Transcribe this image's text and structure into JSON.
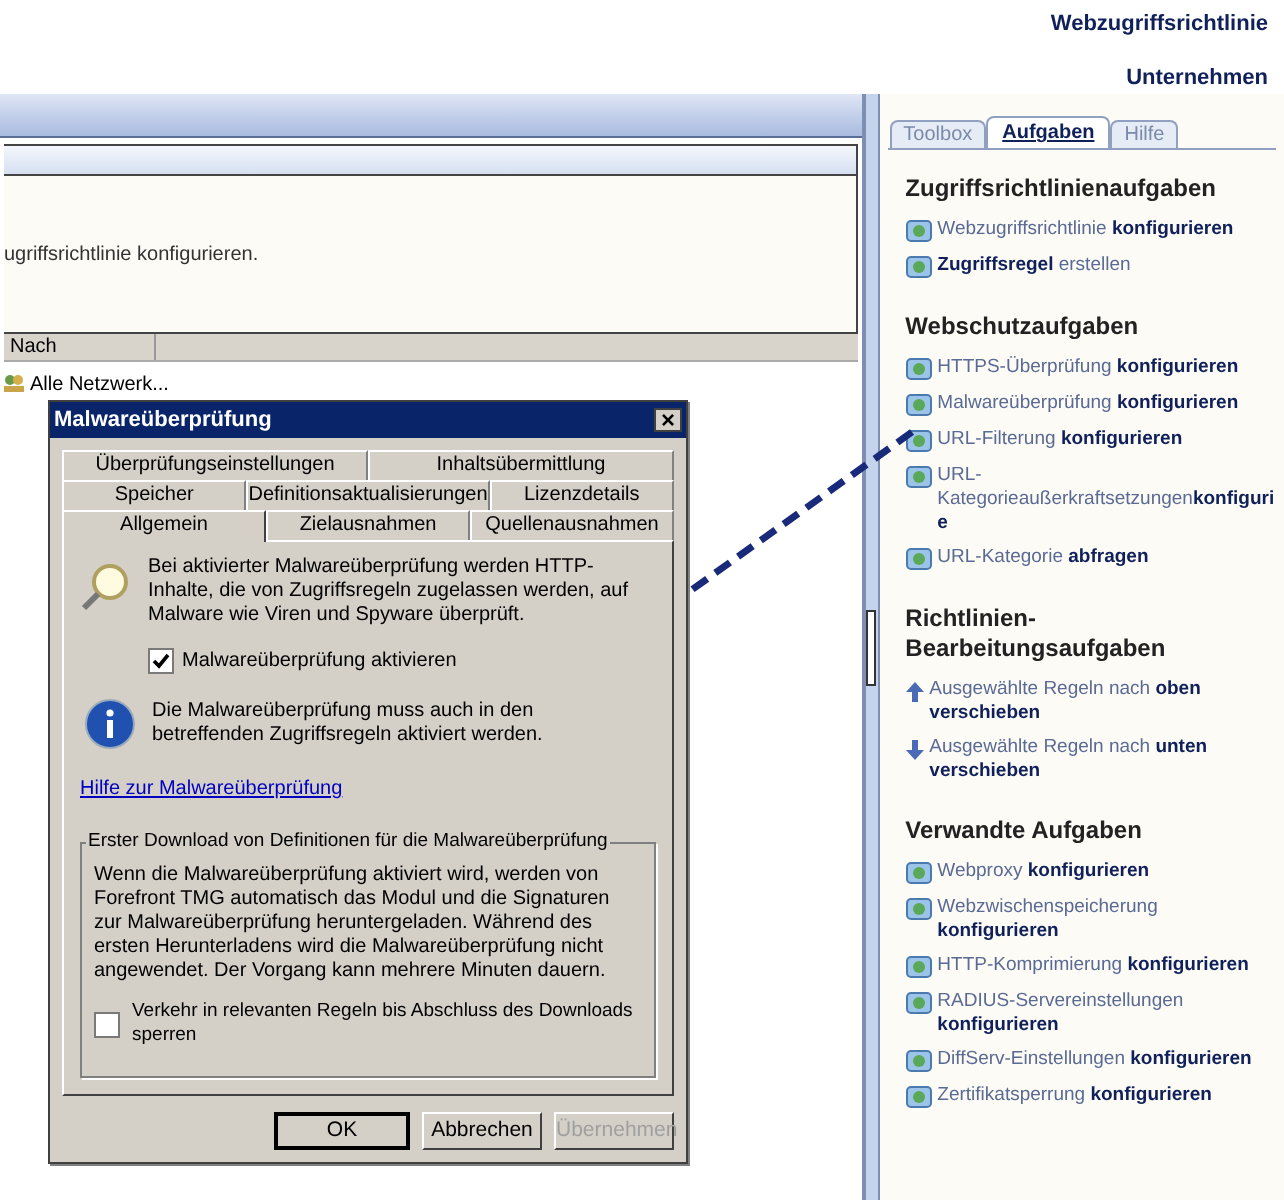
{
  "header": {
    "title": "Webzugriffsrichtlinie",
    "subtitle": "Unternehmen"
  },
  "main": {
    "description": "ugriffsrichtlinie konfigurieren.",
    "columns": [
      "Nach"
    ],
    "rows": [
      {
        "cells": [
          "Alle Netzwerk..."
        ]
      }
    ]
  },
  "dialog": {
    "title": "Malwareüberprüfung",
    "close": "×",
    "tab_rows": [
      [
        {
          "label": "Überprüfungseinstellungen",
          "selected": false
        },
        {
          "label": "Inhaltsübermittlung",
          "selected": false
        }
      ],
      [
        {
          "label": "Speicher",
          "selected": false
        },
        {
          "label": "Definitionsaktualisierungen",
          "selected": false
        },
        {
          "label": "Lizenzdetails",
          "selected": false
        }
      ],
      [
        {
          "label": "Allgemein",
          "selected": true
        },
        {
          "label": "Zielausnahmen",
          "selected": false
        },
        {
          "label": "Quellenausnahmen",
          "selected": false
        }
      ]
    ],
    "intro": "Bei aktivierter Malwareüberprüfung werden HTTP-Inhalte, die von Zugriffsregeln zugelassen werden, auf Malware wie Viren und Spyware überprüft.",
    "enable": {
      "label": "Malwareüberprüfung aktivieren",
      "checked": true
    },
    "info": "Die Malwareüberprüfung muss auch in den betreffenden Zugriffsregeln aktiviert werden.",
    "help_link": "Hilfe zur Malwareüberprüfung",
    "group": {
      "title": "Erster Download von Definitionen für die Malwareüberprüfung",
      "text": "Wenn die Malwareüberprüfung aktiviert wird, werden von Forefront TMG automatisch das Modul und die Signaturen zur Malwareüberprüfung heruntergeladen. Während des ersten Herunterladens wird die Malwareüberprüfung nicht angewendet. Der Vorgang kann mehrere Minuten dauern.",
      "checkbox": {
        "label": "Verkehr in relevanten Regeln bis Abschluss des Downloads sperren",
        "checked": false
      }
    },
    "buttons": [
      {
        "label": "OK",
        "disabled": false
      },
      {
        "label": "Abbrechen",
        "disabled": false
      },
      {
        "label": "Übernehmen",
        "disabled": true
      }
    ]
  },
  "taskpane": {
    "tabs": [
      {
        "label": "Toolbox",
        "selected": false
      },
      {
        "label": "Aufgaben",
        "selected": true
      },
      {
        "label": "Hilfe",
        "selected": false
      }
    ],
    "sections": [
      {
        "title": "Zugriffsrichtlinienaufgaben",
        "items": [
          {
            "kind": "icon",
            "text": "Webzugriffsrichtlinie **konfigurieren**"
          },
          {
            "kind": "icon",
            "text": "**Zugriffsregel** erstellen"
          }
        ]
      },
      {
        "title": "Webschutzaufgaben",
        "items": [
          {
            "kind": "icon",
            "text": "HTTPS-Überprüfung **konfigurieren**"
          },
          {
            "kind": "icon",
            "text": "Malwareüberprüfung **konfigurieren**"
          },
          {
            "kind": "icon",
            "text": "URL-Filterung **konfigurieren**"
          },
          {
            "kind": "icon",
            "text": "URL-Kategorieaußerkraftsetzungen**konfigurie**"
          },
          {
            "kind": "icon",
            "text": "URL-Kategorie **abfragen**"
          }
        ]
      },
      {
        "title": "Richtlinien-Bearbeitungsaufgaben",
        "items": [
          {
            "kind": "up",
            "text": "Ausgewählte Regeln nach **oben verschieben**"
          },
          {
            "kind": "down",
            "text": "Ausgewählte Regeln nach **unten verschieben**"
          }
        ]
      },
      {
        "title": "Verwandte Aufgaben",
        "items": [
          {
            "kind": "icon",
            "text": "Webproxy **konfigurieren**"
          },
          {
            "kind": "icon",
            "text": "Webzwischenspeicherung **konfigurieren**"
          },
          {
            "kind": "icon",
            "text": "HTTP-Komprimierung **konfigurieren**"
          },
          {
            "kind": "icon",
            "text": "RADIUS-Servereinstellungen **konfigurieren**"
          },
          {
            "kind": "icon",
            "text": "DiffServ-Einstellungen **konfigurieren**"
          },
          {
            "kind": "icon",
            "text": "Zertifikatsperrung **konfigurieren**"
          }
        ]
      }
    ]
  }
}
